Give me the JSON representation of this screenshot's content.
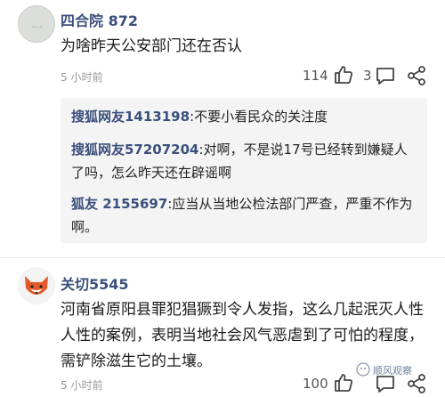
{
  "comments": [
    {
      "username": "四合院 872",
      "content": "为啥昨天公安部门还在否认",
      "time": "5 小时前",
      "likes": "114",
      "replies_count": "3",
      "replies": [
        {
          "name": "搜狐网友1413198",
          "text": ":不要小看民众的关注度"
        },
        {
          "name": "搜狐网友57207204",
          "text": ":对啊，不是说17号已经转到嫌疑人了吗，怎么昨天还在辟谣啊"
        },
        {
          "name": "狐友 2155697",
          "text": ":应当从当地公检法部门严查，严重不作为啊。"
        }
      ]
    },
    {
      "username": "关切5545",
      "content": "河南省原阳县罪犯猖獗到令人发指，这么几起泯灭人性人性的案例，表明当地社会风气恶虐到了可怕的程度，需铲除滋生它的土壤。",
      "time": "5 小时前",
      "likes": "100",
      "watermark": "顺风观察"
    }
  ],
  "icons": {
    "like": "thumbs-up-icon",
    "reply": "comment-icon",
    "share": "share-icon"
  },
  "colors": {
    "username": "#3b4f7c",
    "reply_bg": "#f4f4f4",
    "time": "#999999"
  }
}
